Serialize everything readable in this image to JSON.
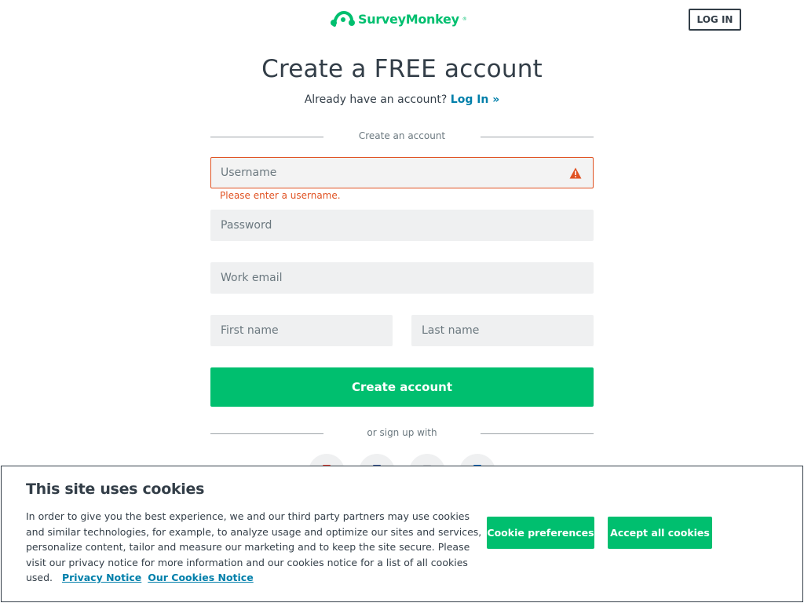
{
  "header": {
    "brand": "SurveyMonkey",
    "brand_mark": "®",
    "login_label": "LOG IN"
  },
  "main": {
    "title": "Create a FREE account",
    "subtitle": "Already have an account?",
    "login_link": "Log In »",
    "divider_top": "Create an account",
    "username_placeholder": "Username",
    "username_error": "Please enter a username.",
    "password_placeholder": "Password",
    "email_placeholder": "Work email",
    "first_name_placeholder": "First name",
    "last_name_placeholder": "Last name",
    "create_button": "Create account",
    "divider_bottom": "or sign up with",
    "social_icons": [
      "google-icon",
      "facebook-icon",
      "apple-icon",
      "linkedin-icon"
    ]
  },
  "cookie_banner": {
    "title": "This site uses cookies",
    "body": "In order to give you the best experience, we and our third party partners may use cookies and similar technologies, for example, to analyze usage and optimize our sites and services, personalize content, tailor and measure our marketing and to keep the site secure. Please visit our privacy notice for more information and our cookies notice for a list of all cookies used.",
    "privacy_link": "Privacy Notice",
    "cookies_link": "Our Cookies Notice",
    "preferences_button": "Cookie preferences",
    "accept_button": "Accept all cookies"
  },
  "colors": {
    "brand_green": "#00bf6f",
    "link_blue": "#007faa",
    "error_orange": "#e05222",
    "text_dark": "#333e48"
  }
}
